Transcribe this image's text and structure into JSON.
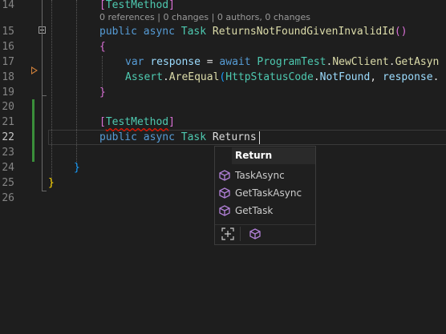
{
  "editor": {
    "lines": [
      {
        "num": "14",
        "active": false,
        "tokens": [
          [
            "br-p",
            "["
          ],
          [
            "attr",
            "TestMethod"
          ],
          [
            "br-p",
            "]"
          ]
        ]
      },
      {
        "num": "15",
        "active": false,
        "tokens": [
          [
            "kw",
            "public"
          ],
          [
            "plain",
            " "
          ],
          [
            "kw",
            "async"
          ],
          [
            "plain",
            " "
          ],
          [
            "type",
            "Task"
          ],
          [
            "plain",
            " "
          ],
          [
            "method",
            "ReturnsNotFoundGivenInvalidId"
          ],
          [
            "br-p",
            "()"
          ]
        ]
      },
      {
        "num": "16",
        "active": false,
        "tokens": [
          [
            "br-p",
            "{"
          ]
        ]
      },
      {
        "num": "17",
        "active": false,
        "tokens": [
          [
            "kw",
            "var"
          ],
          [
            "plain",
            " "
          ],
          [
            "var",
            "response"
          ],
          [
            "plain",
            " = "
          ],
          [
            "kw",
            "await"
          ],
          [
            "plain",
            " "
          ],
          [
            "type",
            "ProgramTest"
          ],
          [
            "plain",
            "."
          ],
          [
            "method",
            "NewClient"
          ],
          [
            "plain",
            "."
          ],
          [
            "method",
            "GetAsyn"
          ]
        ]
      },
      {
        "num": "18",
        "active": false,
        "tokens": [
          [
            "type",
            "Assert"
          ],
          [
            "plain",
            "."
          ],
          [
            "method",
            "AreEqual"
          ],
          [
            "br-b",
            "("
          ],
          [
            "type",
            "HttpStatusCode"
          ],
          [
            "plain",
            "."
          ],
          [
            "var",
            "NotFound"
          ],
          [
            "plain",
            ", "
          ],
          [
            "var",
            "response"
          ],
          [
            "plain",
            "."
          ]
        ]
      },
      {
        "num": "19",
        "active": false,
        "tokens": [
          [
            "br-p",
            "}"
          ]
        ]
      },
      {
        "num": "20",
        "active": false,
        "tokens": []
      },
      {
        "num": "21",
        "active": false,
        "tokens": [
          [
            "br-p",
            "["
          ],
          [
            "attr",
            "TestMethod"
          ],
          [
            "br-p",
            "]"
          ]
        ]
      },
      {
        "num": "22",
        "active": true,
        "tokens": [
          [
            "kw",
            "public"
          ],
          [
            "plain",
            " "
          ],
          [
            "kw",
            "async"
          ],
          [
            "plain",
            " "
          ],
          [
            "type",
            "Task"
          ],
          [
            "plain",
            " Returns"
          ]
        ]
      },
      {
        "num": "23",
        "active": false,
        "tokens": []
      },
      {
        "num": "24",
        "active": false,
        "tokens": [
          [
            "br-b",
            "}"
          ]
        ]
      },
      {
        "num": "25",
        "active": false,
        "tokens": [
          [
            "br-y",
            "}"
          ]
        ]
      },
      {
        "num": "26",
        "active": false,
        "tokens": []
      }
    ],
    "codelens": "0 references | 0 changes | 0 authors, 0 changes"
  },
  "completion": {
    "header": "Return",
    "items": [
      "TaskAsync",
      "GetTaskAsync",
      "GetTask"
    ],
    "icon_color": "#b180d7"
  }
}
